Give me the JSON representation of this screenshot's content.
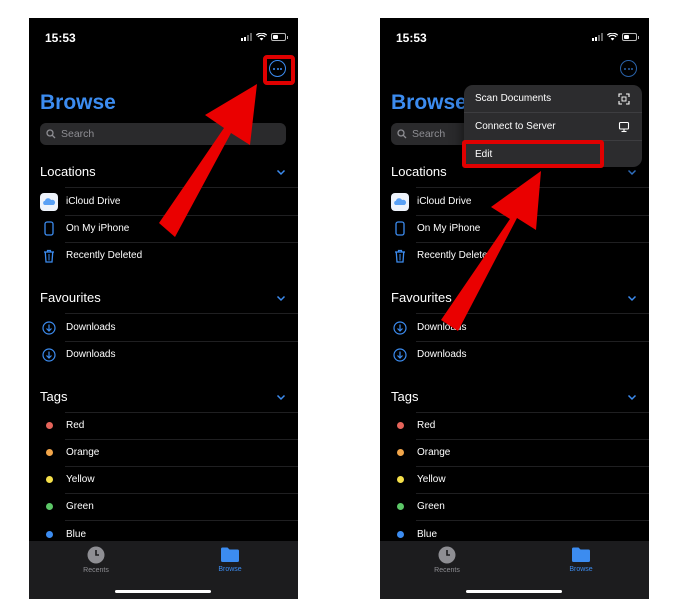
{
  "colors": {
    "accent": "#3c8cf0",
    "highlight": "#e00000",
    "background": "#000000",
    "tabbar": "#1c1c1e"
  },
  "screens": [
    {
      "status_time": "15:53",
      "title": "Browse",
      "search_placeholder": "Search",
      "sections": {
        "locations": "Locations",
        "favourites": "Favourites",
        "tags": "Tags"
      },
      "locations": [
        {
          "label": "iCloud Drive",
          "icon": "icloud-icon"
        },
        {
          "label": "On My iPhone",
          "icon": "iphone-icon"
        },
        {
          "label": "Recently Deleted",
          "icon": "trash-icon"
        }
      ],
      "favourites": [
        {
          "label": "Downloads",
          "icon": "download-icon"
        },
        {
          "label": "Downloads",
          "icon": "download-icon"
        }
      ],
      "tags": [
        {
          "label": "Red",
          "color": "#e5645a"
        },
        {
          "label": "Orange",
          "color": "#f2a64a"
        },
        {
          "label": "Yellow",
          "color": "#f5e04a"
        },
        {
          "label": "Green",
          "color": "#5cc767"
        },
        {
          "label": "Blue",
          "color": "#3c8cf0"
        }
      ],
      "tabs": {
        "recents": "Recents",
        "browse": "Browse"
      }
    },
    {
      "status_time": "15:53",
      "title": "Browse",
      "search_placeholder": "Search",
      "sections": {
        "locations": "Locations",
        "favourites": "Favourites",
        "tags": "Tags"
      },
      "locations": [
        {
          "label": "iCloud Drive",
          "icon": "icloud-icon"
        },
        {
          "label": "On My iPhone",
          "icon": "iphone-icon"
        },
        {
          "label": "Recently Deleted",
          "icon": "trash-icon"
        }
      ],
      "favourites": [
        {
          "label": "Downloads",
          "icon": "download-icon"
        },
        {
          "label": "Downloads",
          "icon": "download-icon"
        }
      ],
      "tags": [
        {
          "label": "Red",
          "color": "#e5645a"
        },
        {
          "label": "Orange",
          "color": "#f2a64a"
        },
        {
          "label": "Yellow",
          "color": "#f5e04a"
        },
        {
          "label": "Green",
          "color": "#5cc767"
        },
        {
          "label": "Blue",
          "color": "#3c8cf0"
        }
      ],
      "tabs": {
        "recents": "Recents",
        "browse": "Browse"
      },
      "menu": [
        {
          "label": "Scan Documents",
          "icon": "scan-icon"
        },
        {
          "label": "Connect to Server",
          "icon": "monitor-icon"
        },
        {
          "label": "Edit",
          "icon": ""
        }
      ]
    }
  ]
}
